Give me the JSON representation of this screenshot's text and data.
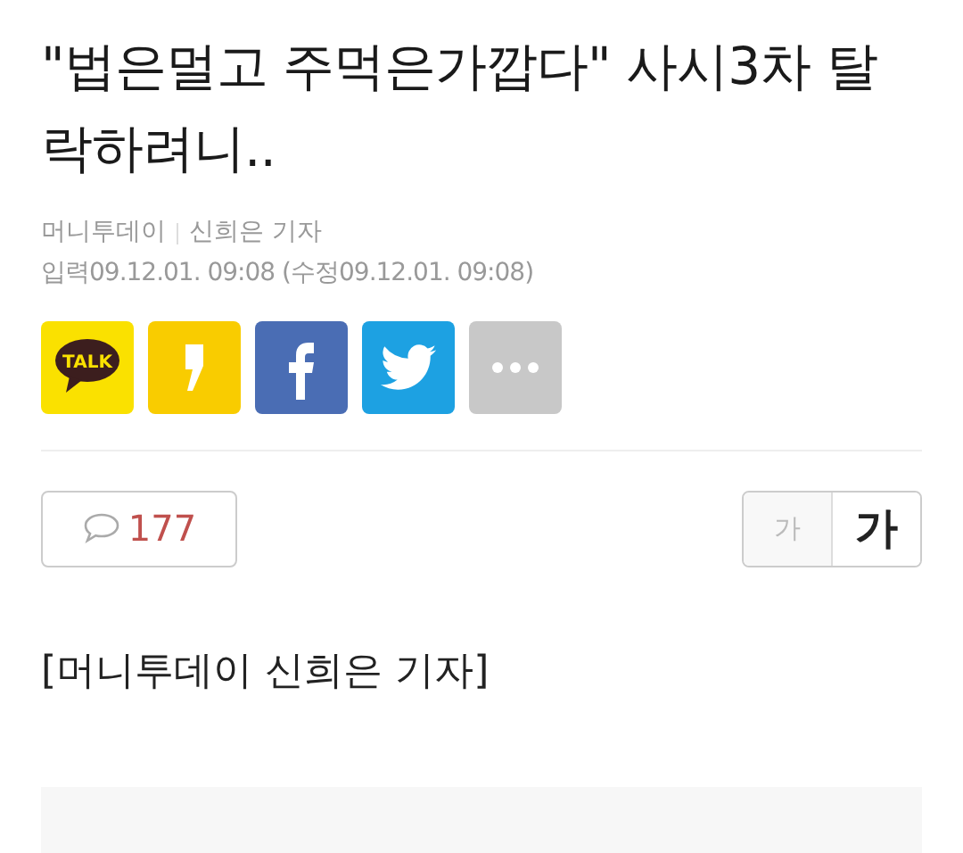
{
  "article": {
    "title": "\"법은멀고 주먹은가깝다\" 사시3차 탈락하려니..",
    "source": "머니투데이",
    "reporter": "신희은 기자",
    "dates": "입력09.12.01. 09:08 (수정09.12.01. 09:08)"
  },
  "share_buttons": [
    {
      "kind": "kakaotalk",
      "label": "TALK"
    },
    {
      "kind": "kakaostory"
    },
    {
      "kind": "facebook"
    },
    {
      "kind": "twitter"
    },
    {
      "kind": "more"
    }
  ],
  "comments": {
    "count": "177"
  },
  "font_size": [
    {
      "label": "가",
      "selected": false
    },
    {
      "label": "가",
      "selected": true
    }
  ],
  "body": "[머니투데이 신희은 기자]"
}
